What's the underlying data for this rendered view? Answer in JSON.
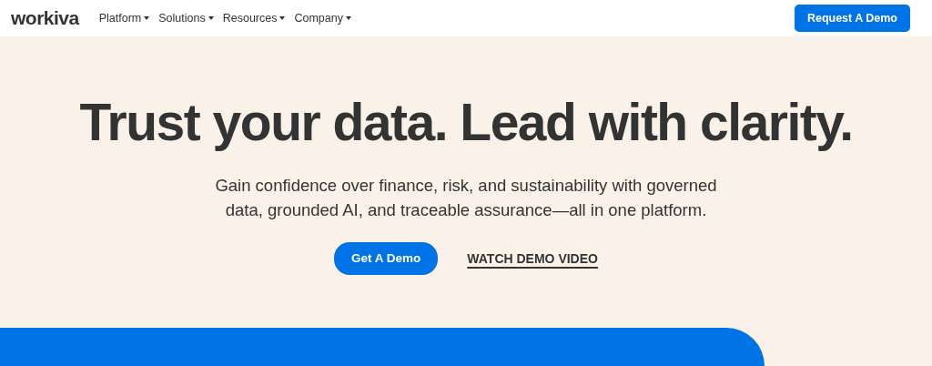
{
  "navbar": {
    "logo": "workiva",
    "menu": [
      {
        "label": "Platform"
      },
      {
        "label": "Solutions"
      },
      {
        "label": "Resources"
      },
      {
        "label": "Company"
      }
    ],
    "cta": "Request A Demo"
  },
  "hero": {
    "heading": "Trust your data. Lead with clarity.",
    "subheading": "Gain confidence over finance, risk, and sustainability with governed data, grounded AI, and traceable assurance—all in one platform.",
    "primary_button": "Get A Demo",
    "secondary_link": "WATCH DEMO VIDEO"
  }
}
